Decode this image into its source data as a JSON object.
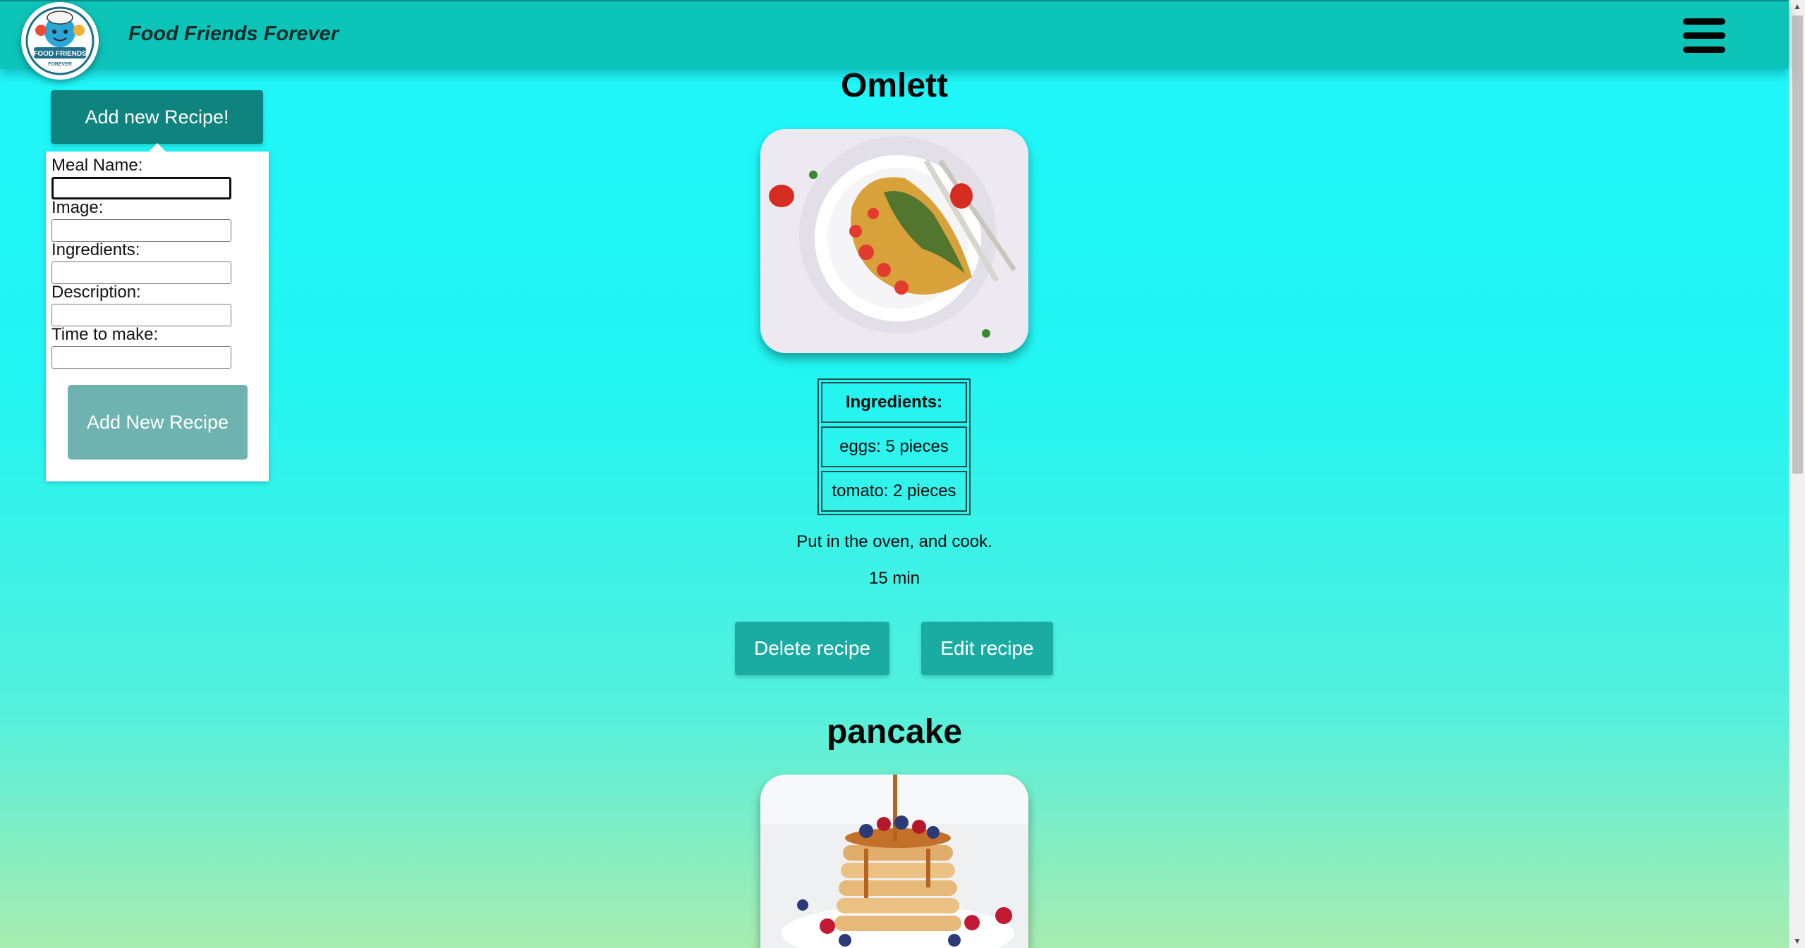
{
  "header": {
    "app_title": "Food Friends Forever",
    "logo_text": "FOOD FRIENDS FOREVER",
    "menu_icon": "hamburger-menu-icon"
  },
  "sidebar": {
    "toggle_label": "Add new Recipe!",
    "form": {
      "meal_name_label": "Meal Name:",
      "meal_name_value": "",
      "image_label": "Image:",
      "image_value": "",
      "ingredients_label": "Ingredients:",
      "ingredients_value": "",
      "description_label": "Description:",
      "description_value": "",
      "time_label": "Time to make:",
      "time_value": "",
      "submit_label": "Add New Recipe"
    }
  },
  "recipes": [
    {
      "title": "Omlett",
      "ingredients_header": "Ingredients:",
      "ingredients": [
        "eggs: 5 pieces",
        "tomato: 2 pieces"
      ],
      "description": "Put in the oven, and cook.",
      "time": "15 min",
      "delete_label": "Delete recipe",
      "edit_label": "Edit recipe"
    },
    {
      "title": "pancake"
    }
  ],
  "colors": {
    "header": "#0cc4b8",
    "toggle_button": "#0f837d",
    "submit_button": "#6fb3b0",
    "action_button": "#1aaca3"
  }
}
